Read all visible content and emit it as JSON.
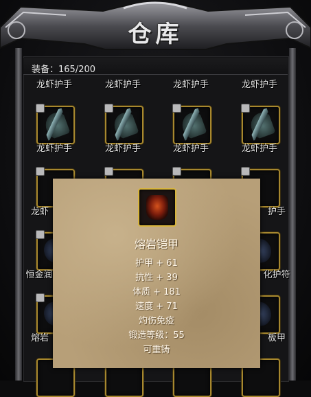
{
  "window": {
    "title": "仓库"
  },
  "inventory": {
    "count_text": "装备：165/200"
  },
  "grid": {
    "top_labels": [
      "龙虾护手",
      "龙虾护手",
      "龙虾护手",
      "龙虾护手"
    ],
    "row1_labels": [
      "龙虾护手",
      "龙虾护手",
      "龙虾护手",
      "龙虾护手"
    ],
    "partial_labels": {
      "r2_left": "龙虾",
      "r2_right": "护手",
      "r3_left": "恒金润",
      "r3_right": "化护符",
      "r4_left": "熔岩",
      "r4_right": "板甲"
    }
  },
  "tooltip": {
    "name": "熔岩铠甲",
    "stats": [
      "护甲 + 61",
      "抗性 + 39",
      "体质 + 181",
      "速度 + 71",
      "灼伤免疫",
      "锻造等级：55",
      "可重铸"
    ]
  },
  "colors": {
    "slot_border": "#a7882f",
    "tooltip_bg": "#b79f78"
  },
  "icons": {
    "item": "gauntlet-icon",
    "armor": "lava-armor-icon",
    "lock": "lock-icon"
  }
}
